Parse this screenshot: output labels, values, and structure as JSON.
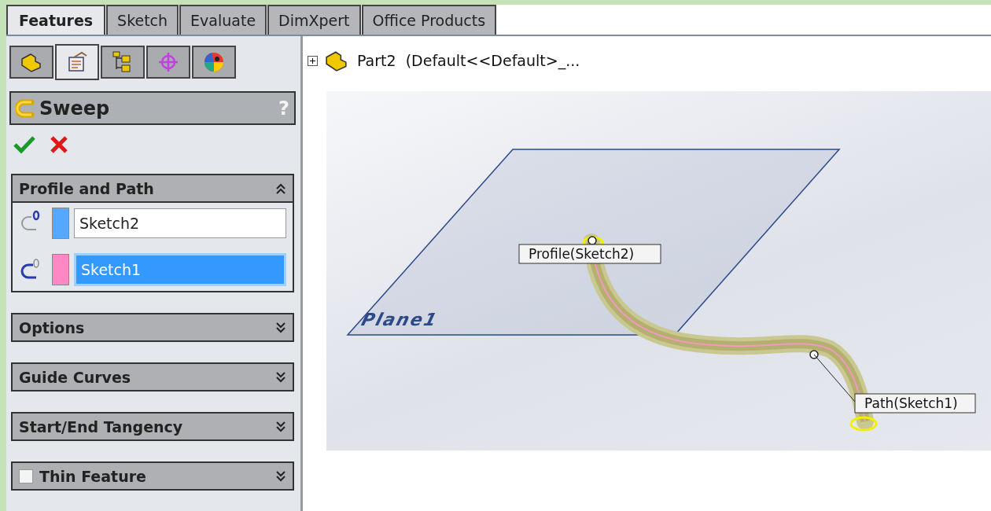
{
  "command_tabs": [
    {
      "label": "Features",
      "selected": true
    },
    {
      "label": "Sketch",
      "selected": false
    },
    {
      "label": "Evaluate",
      "selected": false
    },
    {
      "label": "DimXpert",
      "selected": false
    },
    {
      "label": "Office Products",
      "selected": false
    }
  ],
  "panel_tabs": [
    {
      "kind": "feature-tree",
      "selected": false
    },
    {
      "kind": "property",
      "selected": true
    },
    {
      "kind": "configuration",
      "selected": false
    },
    {
      "kind": "dimxpert",
      "selected": false
    },
    {
      "kind": "display",
      "selected": false
    }
  ],
  "tree": {
    "label": "Part2  (Default<<Default>_...",
    "expanded": false
  },
  "property_manager": {
    "title": "Sweep",
    "help": "?",
    "groups": [
      {
        "title": "Profile and Path",
        "expanded": true,
        "fields": [
          {
            "kind": "profile",
            "color": "#55a8ff",
            "value": "Sketch2",
            "selected": false
          },
          {
            "kind": "path",
            "color": "#ff88c4",
            "value": "Sketch1",
            "selected": true
          }
        ]
      },
      {
        "title": "Options",
        "expanded": false
      },
      {
        "title": "Guide Curves",
        "expanded": false
      },
      {
        "title": "Start/End Tangency",
        "expanded": false
      },
      {
        "title": "Thin Feature",
        "expanded": false,
        "checkbox": true,
        "checked": false
      }
    ]
  },
  "viewport": {
    "plane_label": "Plane1",
    "callouts": [
      {
        "kind": "profile",
        "label": "Profile(Sketch2)"
      },
      {
        "kind": "path",
        "label": "Path(Sketch1)"
      }
    ]
  }
}
